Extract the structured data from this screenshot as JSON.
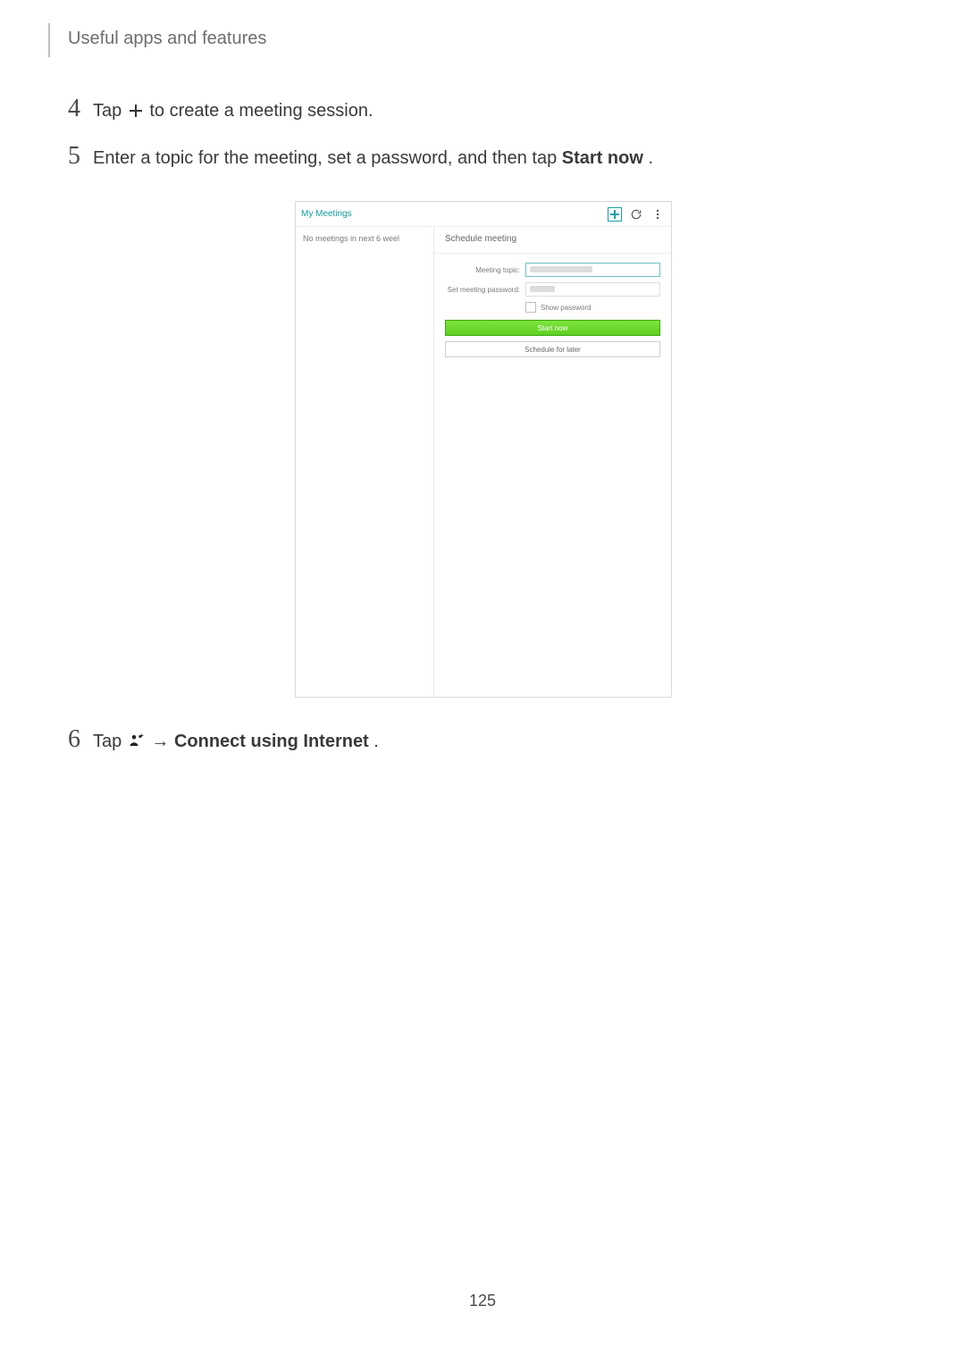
{
  "header": {
    "section_title": "Useful apps and features"
  },
  "steps": {
    "s4": {
      "num": "4",
      "pre": "Tap ",
      "post": " to create a meeting session."
    },
    "s5": {
      "num": "5",
      "pre": "Enter a topic for the meeting, set a password, and then tap ",
      "bold": "Start now",
      "post": "."
    },
    "s6": {
      "num": "6",
      "pre": "Tap ",
      "arrow": " → ",
      "bold": "Connect using Internet",
      "post": "."
    }
  },
  "screenshot": {
    "topbar": {
      "title": "My Meetings"
    },
    "left_panel": {
      "empty_text": "No meetings in next 6 weel"
    },
    "right_panel": {
      "title": "Schedule meeting",
      "topic_label": "Meeting topic:",
      "password_label": "Set meeting password:",
      "show_password": "Show password",
      "start_now": "Start now",
      "schedule_later": "Schedule for later"
    }
  },
  "page_number": "125"
}
